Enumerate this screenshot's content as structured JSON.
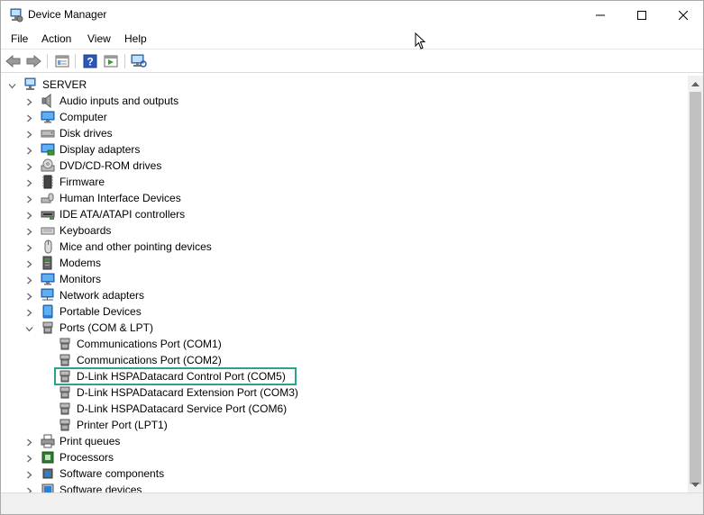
{
  "window": {
    "title": "Device Manager"
  },
  "menubar": {
    "items": [
      "File",
      "Action",
      "View",
      "Help"
    ]
  },
  "toolbar": {
    "buttons": [
      "back-icon",
      "forward-icon",
      "properties-icon",
      "help-icon",
      "run-icon",
      "scan-hardware-icon"
    ]
  },
  "tree": {
    "root": "SERVER",
    "categories": [
      "Audio inputs and outputs",
      "Computer",
      "Disk drives",
      "Display adapters",
      "DVD/CD-ROM drives",
      "Firmware",
      "Human Interface Devices",
      "IDE ATA/ATAPI controllers",
      "Keyboards",
      "Mice and other pointing devices",
      "Modems",
      "Monitors",
      "Network adapters",
      "Portable Devices",
      "Ports (COM & LPT)"
    ],
    "ports": [
      "Communications Port (COM1)",
      "Communications Port (COM2)",
      "D-Link HSPADatacard Control Port (COM5)",
      "D-Link HSPADatacard Extension Port (COM3)",
      "D-Link HSPADatacard Service Port (COM6)",
      "Printer Port (LPT1)"
    ],
    "after": [
      "Print queues",
      "Processors",
      "Software components",
      "Software devices"
    ],
    "selected": "D-Link HSPADatacard Control Port (COM5)"
  },
  "colors": {
    "selection_border": "#2aa38a",
    "scroll_thumb": "#c1c1c1"
  }
}
